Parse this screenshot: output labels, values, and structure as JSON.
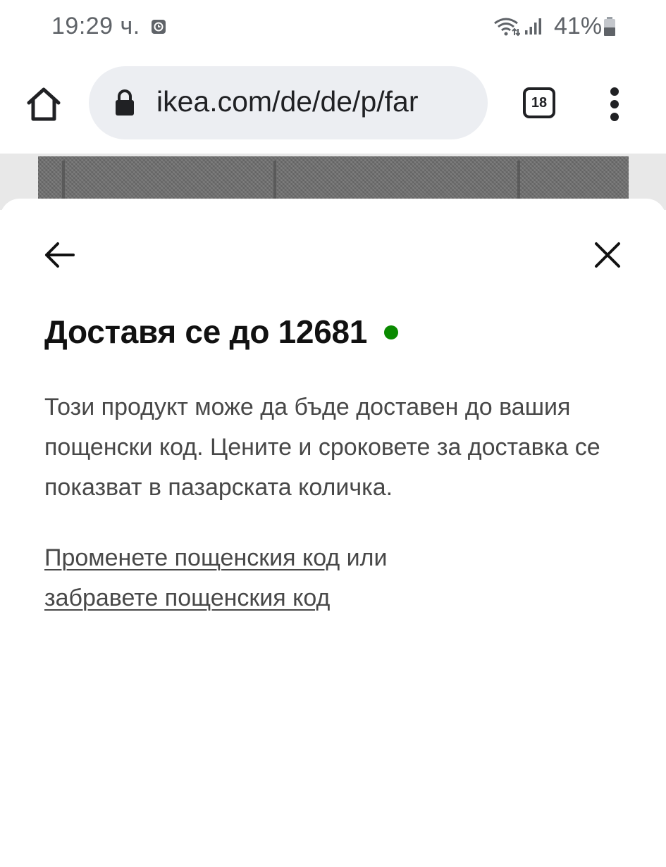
{
  "status_bar": {
    "time": "19:29 ч.",
    "battery": "41%",
    "icons": [
      "clock-app-icon",
      "wifi-icon",
      "signal-icon",
      "battery-icon"
    ]
  },
  "browser": {
    "url": "ikea.com/de/de/p/far",
    "tab_count": "18",
    "icons": [
      "home-icon",
      "lock-icon",
      "tab-switcher-icon",
      "more-menu-icon"
    ]
  },
  "sheet": {
    "title": "Доставя се до 12681",
    "description": "Този продукт може да бъде доставен до вашия пощенски код. Цените и сроковете за доставка се показват в пазарската количка.",
    "change_link": "Променете пощенския код",
    "connector": " или ",
    "forget_link": "забравете пощенския код",
    "icons": [
      "back-arrow-icon",
      "close-icon",
      "availability-dot-icon"
    ]
  },
  "colors": {
    "status_dot": "#0a8a00",
    "omnibox_bg": "#eceef2",
    "text_primary": "#111111",
    "text_secondary": "#484848"
  }
}
